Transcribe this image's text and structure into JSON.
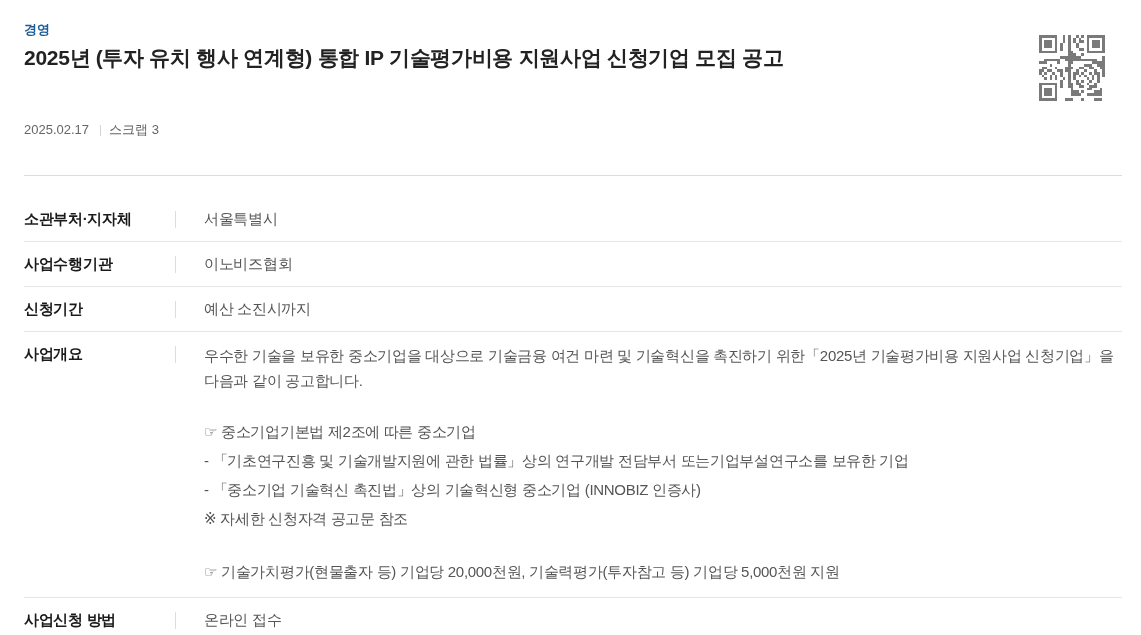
{
  "category": "경영",
  "title": "2025년 (투자 유치 행사 연계형) 통합 IP 기술평가비용 지원사업 신청기업 모집 공고",
  "meta": {
    "date": "2025.02.17",
    "scrap": "스크랩 3"
  },
  "details": [
    {
      "kind": "text",
      "label": "소관부처·지자체",
      "value": "서울특별시"
    },
    {
      "kind": "text",
      "label": "사업수행기관",
      "value": "이노비즈협회"
    },
    {
      "kind": "text",
      "label": "신청기간",
      "value": "예산 소진시까지"
    },
    {
      "kind": "blocks",
      "label": "사업개요",
      "blocks": [
        [
          "우수한 기술을 보유한 중소기업을 대상으로 기술금융 여건 마련 및 기술혁신을 촉진하기 위한「2025년 기술평가비용 지원사업 신청기업」을 다음과 같이 공고합니다."
        ],
        [
          "☞ 중소기업기본법 제2조에 따른 중소기업",
          "- 「기초연구진흥 및 기술개발지원에 관한 법률」상의 연구개발 전담부서 또는기업부설연구소를 보유한 기업",
          "- 「중소기업 기술혁신 촉진법」상의 기술혁신형 중소기업 (INNOBIZ 인증사)",
          "※ 자세한 신청자격 공고문 참조"
        ],
        [
          "☞ 기술가치평가(현물출자 등) 기업당 20,000천원, 기술력평가(투자참고 등) 기업당 5,000천원 지원"
        ]
      ]
    },
    {
      "kind": "text",
      "label": "사업신청 방법",
      "value": "온라인 접수"
    }
  ]
}
